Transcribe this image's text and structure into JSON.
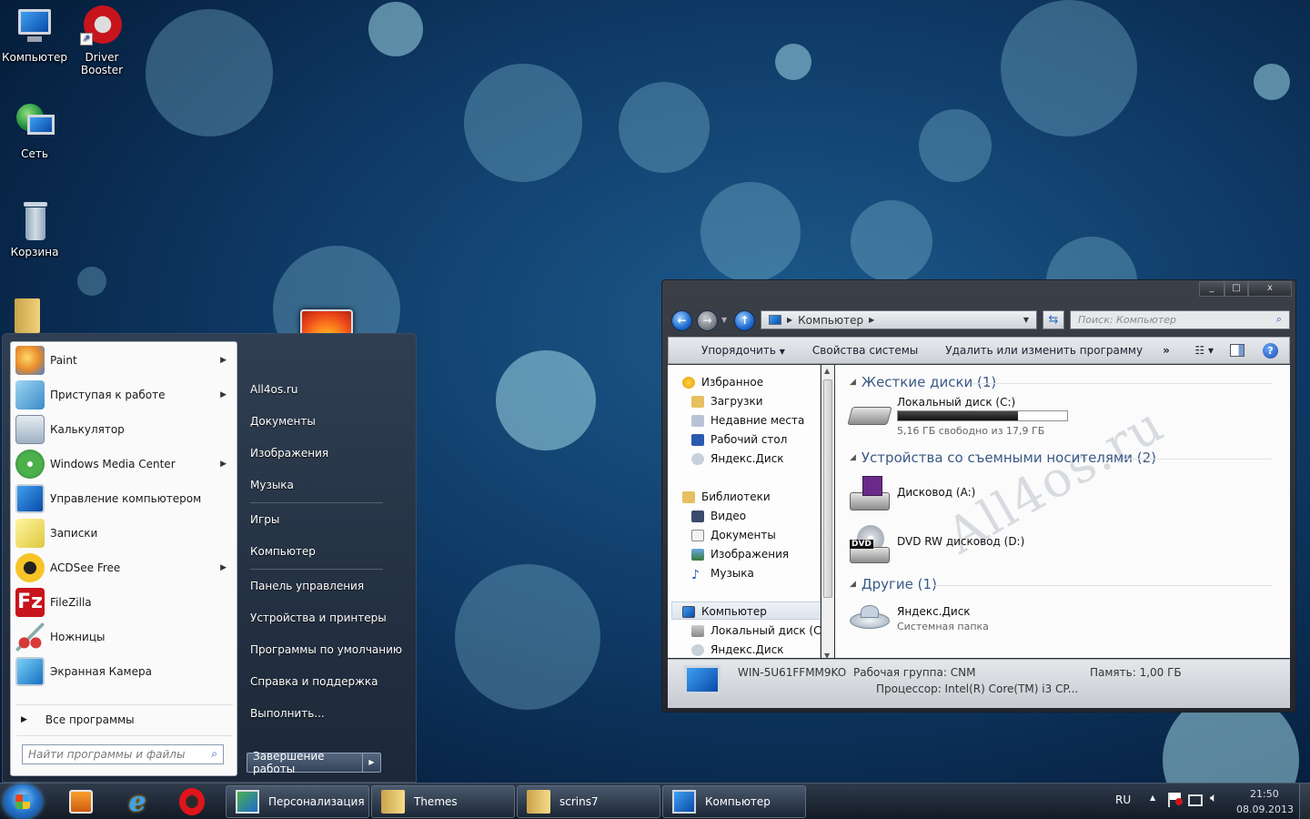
{
  "desktop": {
    "icons": [
      {
        "label": "Компьютер",
        "icon": "computer-icon"
      },
      {
        "label": "Driver Booster",
        "icon": "driver-booster-icon"
      },
      {
        "label": "Сеть",
        "icon": "network-icon"
      },
      {
        "label": "Корзина",
        "icon": "recycle-bin-icon"
      }
    ]
  },
  "start_menu": {
    "programs": [
      {
        "label": "Paint",
        "icon": "paint-icon",
        "submenu": true
      },
      {
        "label": "Приступая к работе",
        "icon": "getting-started-icon",
        "submenu": true
      },
      {
        "label": "Калькулятор",
        "icon": "calculator-icon",
        "submenu": false
      },
      {
        "label": "Windows Media Center",
        "icon": "media-center-icon",
        "submenu": true
      },
      {
        "label": "Управление компьютером",
        "icon": "computer-management-icon",
        "submenu": false
      },
      {
        "label": "Записки",
        "icon": "sticky-notes-icon",
        "submenu": false
      },
      {
        "label": "ACDSee Free",
        "icon": "acdsee-icon",
        "submenu": true
      },
      {
        "label": "FileZilla",
        "icon": "filezilla-icon",
        "submenu": false
      },
      {
        "label": "Ножницы",
        "icon": "scissors-icon",
        "submenu": false
      },
      {
        "label": "Экранная Камера",
        "icon": "screen-camera-icon",
        "submenu": false
      }
    ],
    "all_programs": "Все программы",
    "search_placeholder": "Найти программы и файлы",
    "right_items": [
      "All4os.ru",
      "Документы",
      "Изображения",
      "Музыка",
      "Игры",
      "Компьютер",
      "Панель управления",
      "Устройства и принтеры",
      "Программы по умолчанию",
      "Справка и поддержка",
      "Выполнить..."
    ],
    "shutdown_label": "Завершение работы"
  },
  "explorer": {
    "window_buttons": [
      "_",
      "□",
      "x"
    ],
    "address": "Компьютер",
    "search_placeholder": "Поиск: Компьютер",
    "toolbar": {
      "organize": "Упорядочить",
      "system_properties": "Свойства системы",
      "uninstall": "Удалить или изменить программу",
      "more": "»"
    },
    "nav": {
      "favorites": "Избранное",
      "fav_items": [
        "Загрузки",
        "Недавние места",
        "Рабочий стол",
        "Яндекс.Диск"
      ],
      "libraries": "Библиотеки",
      "lib_items": [
        "Видео",
        "Документы",
        "Изображения",
        "Музыка"
      ],
      "computer": "Компьютер",
      "comp_items": [
        "Локальный диск (C:)",
        "Яндекс.Диск"
      ]
    },
    "groups": {
      "hdd": "Жесткие диски (1)",
      "removable": "Устройства со съемными носителями (2)",
      "other": "Другие (1)"
    },
    "drives": {
      "c_name": "Локальный диск (C:)",
      "c_free": "5,16 ГБ свободно из 17,9 ГБ",
      "c_used_fraction": 0.71,
      "a_name": "Дисковод (A:)",
      "d_name": "DVD RW дисковод (D:)",
      "dvd_badge": "DVD",
      "yandex_name": "Яндекс.Диск",
      "yandex_sub": "Системная папка"
    },
    "watermark": "All4os.ru",
    "details": {
      "computer_name": "WIN-5U61FFMM9KO",
      "workgroup": "Рабочая группа: CNM",
      "memory": "Память: 1,00 ГБ",
      "processor": "Процессор: Intel(R) Core(TM) i3 CP..."
    }
  },
  "taskbar": {
    "tasks": [
      {
        "label": "Персонализация",
        "icon": "personalization-icon"
      },
      {
        "label": "Themes",
        "icon": "folder-icon"
      },
      {
        "label": "scrins7",
        "icon": "folder-icon"
      },
      {
        "label": "Компьютер",
        "icon": "computer-icon"
      }
    ],
    "lang": "RU",
    "time": "21:50",
    "date": "08.09.2013"
  }
}
